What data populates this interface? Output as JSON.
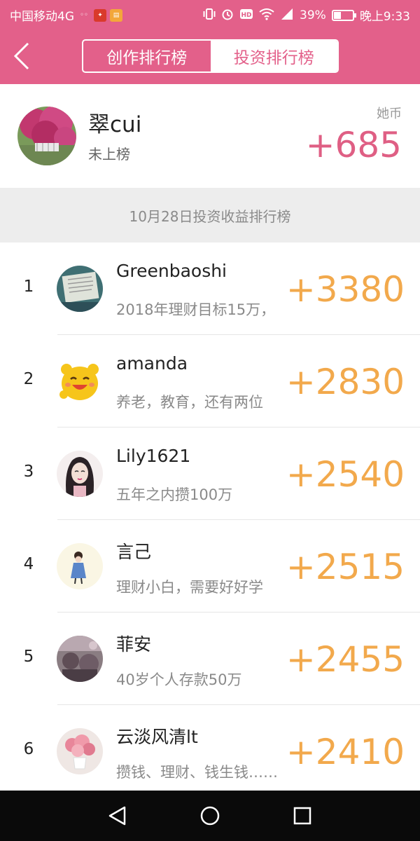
{
  "status_bar": {
    "carrier": "中国移动4G",
    "battery_percent": "39%",
    "battery_level": 0.39,
    "time": "晚上9:33",
    "app_icons": [
      "notification-icon",
      "toutiao-app-icon",
      "app-icon"
    ]
  },
  "header": {
    "tabs": [
      {
        "label": "创作排行榜",
        "active": false
      },
      {
        "label": "投资排行榜",
        "active": true
      }
    ]
  },
  "me": {
    "name": "翠cui",
    "status": "未上榜",
    "unit": "她币",
    "score": "+685"
  },
  "section_title": "10月28日投资收益排行榜",
  "ranking": [
    {
      "rank": "1",
      "name": "Greenbaoshi",
      "desc": "2018年理财目标15万，",
      "score": "+3380"
    },
    {
      "rank": "2",
      "name": "amanda",
      "desc": "养老，教育，还有两位",
      "score": "+2830"
    },
    {
      "rank": "3",
      "name": "Lily1621",
      "desc": "五年之内攒100万",
      "score": "+2540"
    },
    {
      "rank": "4",
      "name": "言己",
      "desc": "理财小白，需要好好学",
      "score": "+2515"
    },
    {
      "rank": "5",
      "name": "菲安",
      "desc": "40岁个人存款50万",
      "score": "+2455"
    },
    {
      "rank": "6",
      "name": "云淡风清lt",
      "desc": "攒钱、理财、钱生钱……",
      "score": "+2410"
    }
  ],
  "colors": {
    "brand": "#e3608a",
    "score_orange": "#f2a94c",
    "my_score": "#df5f84"
  }
}
